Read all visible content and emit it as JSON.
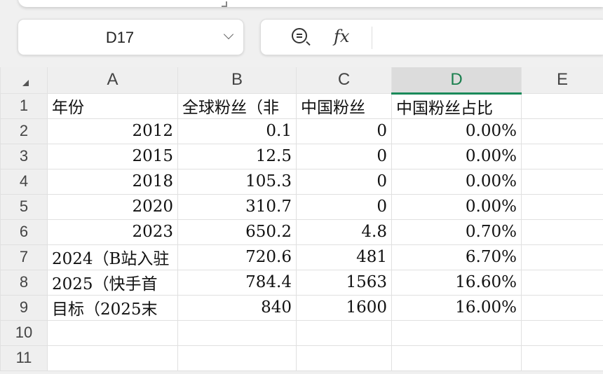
{
  "name_box": {
    "value": "D17"
  },
  "formula_bar": {
    "value": ""
  },
  "columns": [
    "A",
    "B",
    "C",
    "D",
    "E"
  ],
  "selected_column": "D",
  "rows": [
    {
      "n": "1",
      "cells": [
        "年份",
        "全球粉丝（非",
        "中国粉丝",
        "中国粉丝占比",
        ""
      ]
    },
    {
      "n": "2",
      "cells": [
        "2012",
        "0.1",
        "0",
        "0.00%",
        ""
      ]
    },
    {
      "n": "3",
      "cells": [
        "2015",
        "12.5",
        "0",
        "0.00%",
        ""
      ]
    },
    {
      "n": "4",
      "cells": [
        "2018",
        "105.3",
        "0",
        "0.00%",
        ""
      ]
    },
    {
      "n": "5",
      "cells": [
        "2020",
        "310.7",
        "0",
        "0.00%",
        ""
      ]
    },
    {
      "n": "6",
      "cells": [
        "2023",
        "650.2",
        "4.8",
        "0.70%",
        ""
      ]
    },
    {
      "n": "7",
      "cells": [
        "2024（B站入驻",
        "720.6",
        "481",
        "6.70%",
        ""
      ]
    },
    {
      "n": "8",
      "cells": [
        "2025（快手首",
        "784.4",
        "1563",
        "16.60%",
        ""
      ]
    },
    {
      "n": "9",
      "cells": [
        "目标（2025末",
        "840",
        "1600",
        "16.00%",
        ""
      ]
    },
    {
      "n": "10",
      "cells": [
        "",
        "",
        "",
        "",
        ""
      ]
    },
    {
      "n": "11",
      "cells": [
        "",
        "",
        "",
        "",
        ""
      ]
    }
  ]
}
